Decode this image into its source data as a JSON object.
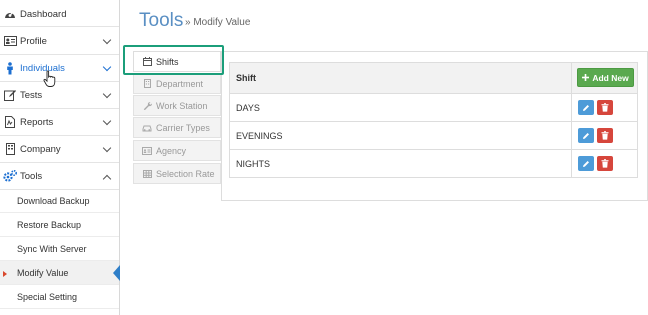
{
  "sidebar": {
    "items": [
      {
        "label": "Dashboard",
        "icon": "dashboard-icon"
      },
      {
        "label": "Profile",
        "icon": "id-card-icon"
      },
      {
        "label": "Individuals",
        "icon": "person-icon"
      },
      {
        "label": "Tests",
        "icon": "edit-icon"
      },
      {
        "label": "Reports",
        "icon": "report-icon"
      },
      {
        "label": "Company",
        "icon": "building-icon"
      },
      {
        "label": "Tools",
        "icon": "cogs-icon"
      }
    ],
    "tools_sub": [
      {
        "label": "Download Backup"
      },
      {
        "label": "Restore Backup"
      },
      {
        "label": "Sync With Server"
      },
      {
        "label": "Modify Value"
      },
      {
        "label": "Special Setting"
      }
    ]
  },
  "header": {
    "title": "Tools",
    "breadcrumb": "» Modify Value"
  },
  "tabs": [
    {
      "label": "Shifts",
      "icon": "calendar-icon"
    },
    {
      "label": "Department",
      "icon": "building-icon"
    },
    {
      "label": "Work Station",
      "icon": "wrench-icon"
    },
    {
      "label": "Carrier Types",
      "icon": "car-icon"
    },
    {
      "label": "Agency",
      "icon": "id-card-icon"
    },
    {
      "label": "Selection Rate",
      "icon": "table-icon"
    }
  ],
  "table": {
    "header": "Shift",
    "add_label": "Add New",
    "rows": [
      "DAYS",
      "EVENINGS",
      "NIGHTS"
    ]
  },
  "colors": {
    "accent_blue": "#1c6fd1",
    "title_blue": "#5a8fc3",
    "add_green": "#5aa94f",
    "edit_blue": "#4d9bd8",
    "delete_red": "#d6463c",
    "highlight_green": "#1b9e7a"
  }
}
